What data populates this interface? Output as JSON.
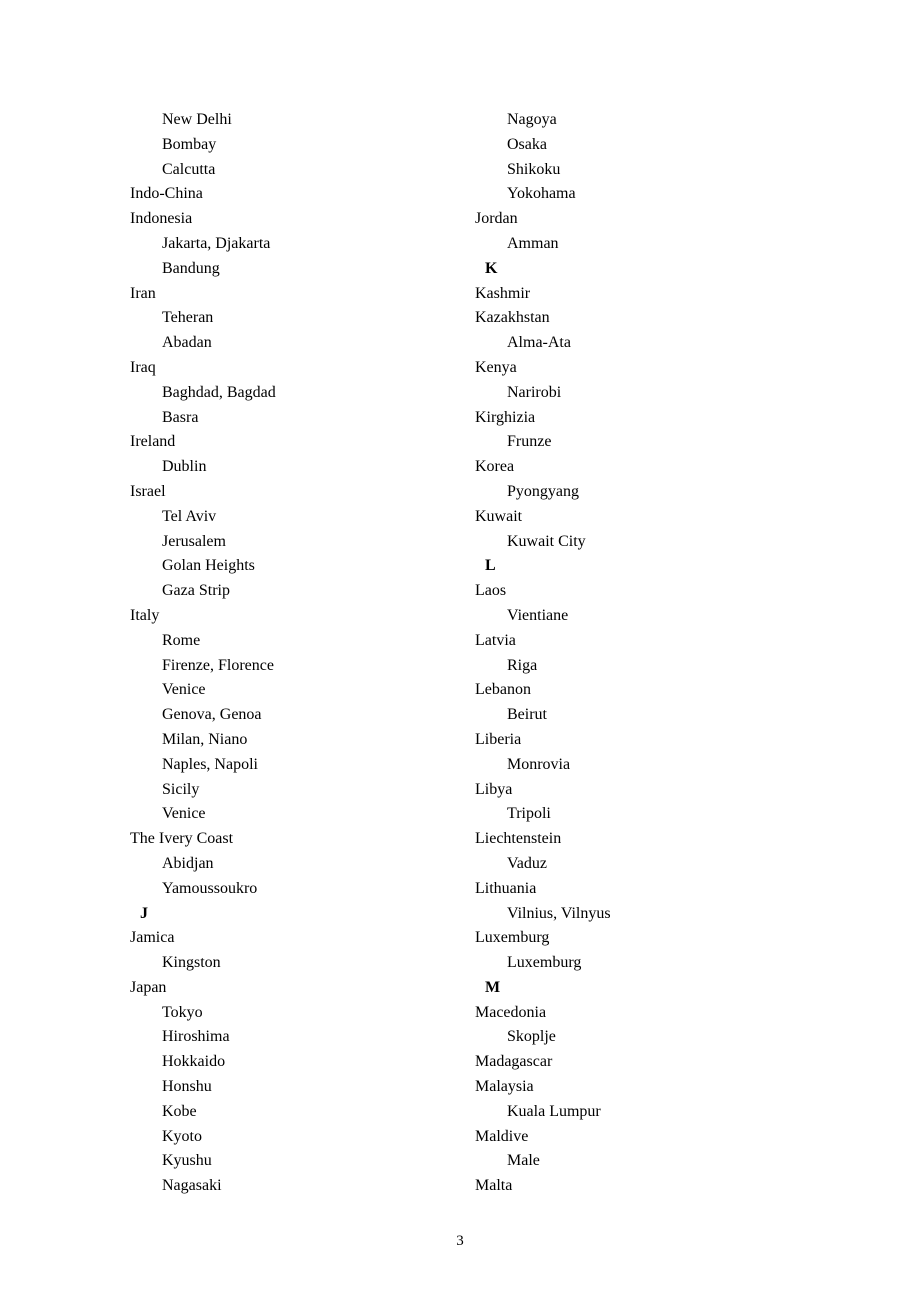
{
  "page_number": "3",
  "left_column": [
    {
      "type": "city",
      "text": "New Delhi"
    },
    {
      "type": "city",
      "text": "Bombay"
    },
    {
      "type": "city",
      "text": "Calcutta"
    },
    {
      "type": "country",
      "text": "Indo-China"
    },
    {
      "type": "country",
      "text": "Indonesia"
    },
    {
      "type": "city",
      "text": "Jakarta, Djakarta"
    },
    {
      "type": "city",
      "text": "Bandung"
    },
    {
      "type": "country",
      "text": "Iran"
    },
    {
      "type": "city",
      "text": "Teheran"
    },
    {
      "type": "city",
      "text": "Abadan"
    },
    {
      "type": "country",
      "text": "Iraq"
    },
    {
      "type": "city",
      "text": "Baghdad, Bagdad"
    },
    {
      "type": "city",
      "text": "Basra"
    },
    {
      "type": "country",
      "text": "Ireland"
    },
    {
      "type": "city",
      "text": "Dublin"
    },
    {
      "type": "country",
      "text": "Israel"
    },
    {
      "type": "city",
      "text": "Tel Aviv"
    },
    {
      "type": "city",
      "text": "Jerusalem"
    },
    {
      "type": "city",
      "text": "Golan Heights"
    },
    {
      "type": "city",
      "text": "Gaza Strip"
    },
    {
      "type": "country",
      "text": "Italy"
    },
    {
      "type": "city",
      "text": "Rome"
    },
    {
      "type": "city",
      "text": "Firenze, Florence"
    },
    {
      "type": "city",
      "text": "Venice"
    },
    {
      "type": "city",
      "text": "Genova, Genoa"
    },
    {
      "type": "city",
      "text": "Milan, Niano"
    },
    {
      "type": "city",
      "text": "Naples, Napoli"
    },
    {
      "type": "city",
      "text": "Sicily"
    },
    {
      "type": "city",
      "text": "Venice"
    },
    {
      "type": "country",
      "text": "The Ivery Coast"
    },
    {
      "type": "city",
      "text": "Abidjan"
    },
    {
      "type": "city",
      "text": "Yamoussoukro"
    },
    {
      "type": "letter",
      "text": "J"
    },
    {
      "type": "country",
      "text": "Jamica"
    },
    {
      "type": "city",
      "text": "Kingston"
    },
    {
      "type": "country",
      "text": "Japan"
    },
    {
      "type": "city",
      "text": "Tokyo"
    },
    {
      "type": "city",
      "text": "Hiroshima"
    },
    {
      "type": "city",
      "text": "Hokkaido"
    },
    {
      "type": "city",
      "text": "Honshu"
    },
    {
      "type": "city",
      "text": "Kobe"
    },
    {
      "type": "city",
      "text": "Kyoto"
    },
    {
      "type": "city",
      "text": "Kyushu"
    },
    {
      "type": "city",
      "text": "Nagasaki"
    }
  ],
  "right_column": [
    {
      "type": "city",
      "text": "Nagoya"
    },
    {
      "type": "city",
      "text": "Osaka"
    },
    {
      "type": "city",
      "text": "Shikoku"
    },
    {
      "type": "city",
      "text": "Yokohama"
    },
    {
      "type": "country",
      "text": "Jordan"
    },
    {
      "type": "city",
      "text": "Amman"
    },
    {
      "type": "letter",
      "text": "K"
    },
    {
      "type": "country",
      "text": "Kashmir"
    },
    {
      "type": "country",
      "text": "Kazakhstan"
    },
    {
      "type": "city",
      "text": "Alma-Ata"
    },
    {
      "type": "country",
      "text": "Kenya"
    },
    {
      "type": "city",
      "text": "Narirobi"
    },
    {
      "type": "country",
      "text": "Kirghizia"
    },
    {
      "type": "city",
      "text": "Frunze"
    },
    {
      "type": "country",
      "text": "Korea"
    },
    {
      "type": "city",
      "text": "Pyongyang"
    },
    {
      "type": "country",
      "text": "Kuwait"
    },
    {
      "type": "city",
      "text": "Kuwait City"
    },
    {
      "type": "letter",
      "text": "L"
    },
    {
      "type": "country",
      "text": "Laos"
    },
    {
      "type": "city",
      "text": "Vientiane"
    },
    {
      "type": "country",
      "text": "Latvia"
    },
    {
      "type": "city",
      "text": "Riga"
    },
    {
      "type": "country",
      "text": "Lebanon"
    },
    {
      "type": "city",
      "text": "Beirut"
    },
    {
      "type": "country",
      "text": "Liberia"
    },
    {
      "type": "city",
      "text": "Monrovia"
    },
    {
      "type": "country",
      "text": "Libya"
    },
    {
      "type": "city",
      "text": "Tripoli"
    },
    {
      "type": "country",
      "text": "Liechtenstein"
    },
    {
      "type": "city",
      "text": "Vaduz"
    },
    {
      "type": "country",
      "text": "Lithuania"
    },
    {
      "type": "city",
      "text": "Vilnius, Vilnyus"
    },
    {
      "type": "country",
      "text": "Luxemburg"
    },
    {
      "type": "city",
      "text": "Luxemburg"
    },
    {
      "type": "letter",
      "text": "M"
    },
    {
      "type": "country",
      "text": "Macedonia"
    },
    {
      "type": "city",
      "text": "Skoplje"
    },
    {
      "type": "country",
      "text": "Madagascar"
    },
    {
      "type": "country",
      "text": "Malaysia"
    },
    {
      "type": "city",
      "text": "Kuala Lumpur"
    },
    {
      "type": "country",
      "text": "Maldive"
    },
    {
      "type": "city",
      "text": "Male"
    },
    {
      "type": "country",
      "text": "Malta"
    }
  ]
}
